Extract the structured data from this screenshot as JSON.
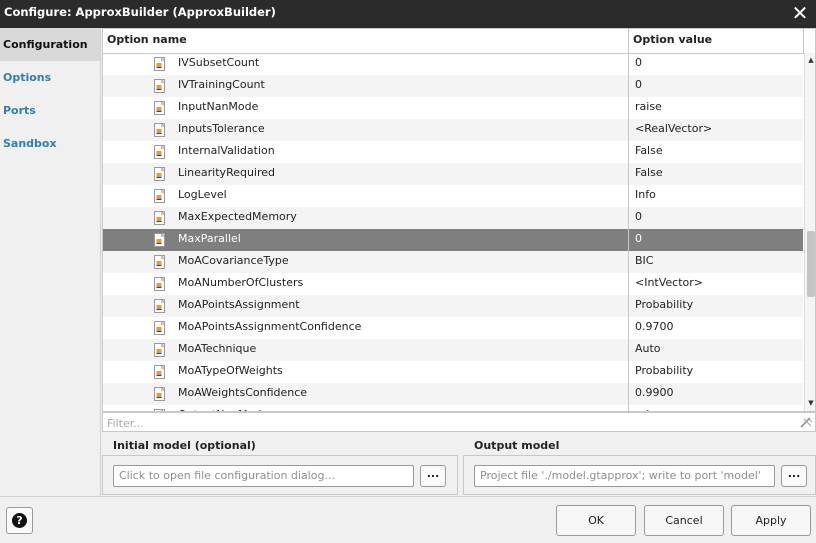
{
  "window": {
    "title": "Configure: ApproxBuilder (ApproxBuilder)",
    "close_icon": "close-icon"
  },
  "nav": [
    {
      "label": "Configuration",
      "active": true
    },
    {
      "label": "Options",
      "active": false
    },
    {
      "label": "Ports",
      "active": false
    },
    {
      "label": "Sandbox",
      "active": false
    }
  ],
  "table": {
    "header_name": "Option name",
    "header_value": "Option value",
    "row_icon": "option-icon",
    "selected_row": "MaxParallel",
    "rows": [
      {
        "name": "IVSubsetCount",
        "value": "0"
      },
      {
        "name": "IVTrainingCount",
        "value": "0"
      },
      {
        "name": "InputNanMode",
        "value": "raise"
      },
      {
        "name": "InputsTolerance",
        "value": "<RealVector>"
      },
      {
        "name": "InternalValidation",
        "value": "False"
      },
      {
        "name": "LinearityRequired",
        "value": "False"
      },
      {
        "name": "LogLevel",
        "value": "Info"
      },
      {
        "name": "MaxExpectedMemory",
        "value": "0"
      },
      {
        "name": "MaxParallel",
        "value": "0"
      },
      {
        "name": "MoACovarianceType",
        "value": "BIC"
      },
      {
        "name": "MoANumberOfClusters",
        "value": "<IntVector>"
      },
      {
        "name": "MoAPointsAssignment",
        "value": "Probability"
      },
      {
        "name": "MoAPointsAssignmentConfidence",
        "value": "0.9700"
      },
      {
        "name": "MoATechnique",
        "value": "Auto"
      },
      {
        "name": "MoATypeOfWeights",
        "value": "Probability"
      },
      {
        "name": "MoAWeightsConfidence",
        "value": "0.9900"
      },
      {
        "name": "OutputNanMode",
        "value": "raise"
      }
    ]
  },
  "filter": {
    "placeholder": "Filter...",
    "value": ""
  },
  "initial_model": {
    "label": "Initial model (optional)",
    "field_text": "Click to open file configuration dialog...",
    "browse_label": "..."
  },
  "output_model": {
    "label": "Output model",
    "field_text": "Project file './model.gtapprox'; write to port 'model'",
    "browse_label": "..."
  },
  "footer": {
    "help_label": "?",
    "ok_label": "OK",
    "cancel_label": "Cancel",
    "apply_label": "Apply"
  },
  "colors": {
    "titlebar": "#2b2b2b",
    "nav_link": "#2e7fb4",
    "selected_row": "#7f7f7f"
  }
}
